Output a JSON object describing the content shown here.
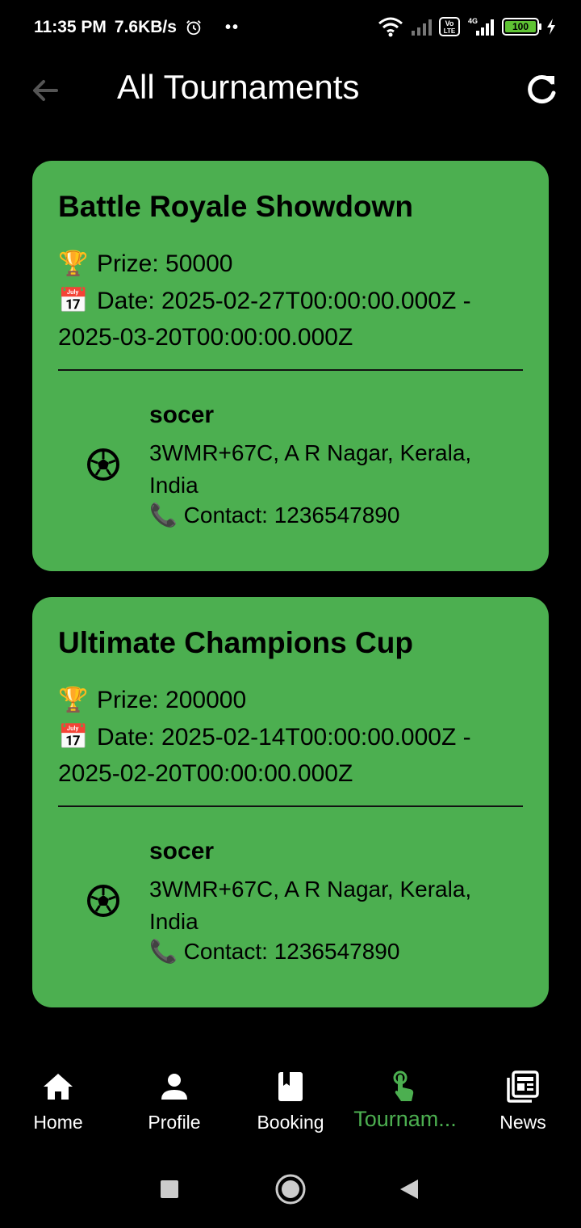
{
  "status_bar": {
    "time": "11:35 PM",
    "speed": "7.6KB/s",
    "dots": "••",
    "battery": "100",
    "network_label": "4G"
  },
  "app_bar": {
    "title": "All Tournaments"
  },
  "tournaments": [
    {
      "name": "Battle Royale Showdown",
      "prize": "Prize: 50000",
      "date_line1": "Date: 2025-02-27T00:00:00.000Z -",
      "date_line2": "2025-03-20T00:00:00.000Z",
      "venue_name": "socer",
      "venue_address": "3WMR+67C, A R Nagar, Kerala, India",
      "contact": "Contact: 1236547890"
    },
    {
      "name": "Ultimate Champions Cup",
      "prize": "Prize: 200000",
      "date_line1": "Date: 2025-02-14T00:00:00.000Z -",
      "date_line2": "2025-02-20T00:00:00.000Z",
      "venue_name": "socer",
      "venue_address": "3WMR+67C, A R Nagar, Kerala, India",
      "contact": "Contact: 1236547890"
    }
  ],
  "emojis": {
    "trophy": "🏆",
    "calendar": "📅",
    "phone": "📞"
  },
  "bottom_nav": {
    "items": [
      {
        "label": "Home",
        "icon": "home-icon"
      },
      {
        "label": "Profile",
        "icon": "person-icon"
      },
      {
        "label": "Booking",
        "icon": "book-icon"
      },
      {
        "label": "Tournam...",
        "icon": "touch-icon"
      },
      {
        "label": "News",
        "icon": "news-icon"
      }
    ],
    "active_index": 3
  },
  "colors": {
    "card": "#4caf50",
    "accent": "#4caf50",
    "background": "#000000"
  }
}
